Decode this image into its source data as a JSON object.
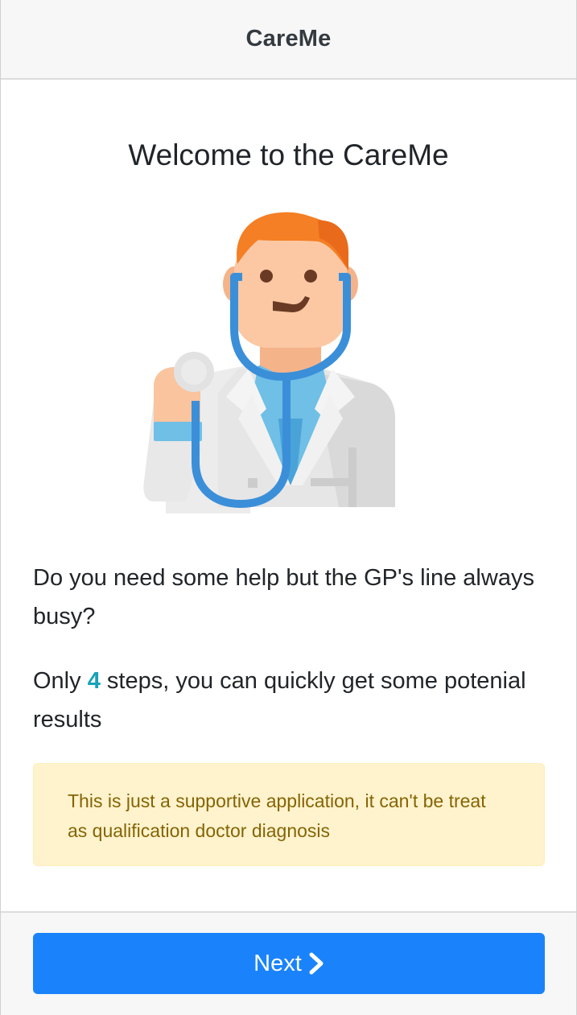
{
  "navbar": {
    "title": "CareMe"
  },
  "welcome": {
    "title": "Welcome to the CareMe"
  },
  "illustration": {
    "icon": "doctor-with-stethoscope-icon"
  },
  "intro": {
    "question": "Do you need some help but the GP's line always busy?",
    "steps_prefix": "Only ",
    "steps_count": "4",
    "steps_suffix": " steps, you can quickly get some potenial results"
  },
  "disclaimer": {
    "text": "This is just a supportive application, it can't be treat as qualification doctor diagnosis"
  },
  "footer": {
    "next_label": "Next",
    "next_icon": "chevron-right-icon"
  },
  "colors": {
    "primary": "#1a83fb",
    "info": "#17a2b8",
    "warning_bg": "#fff3cd",
    "warning_text": "#856404"
  }
}
